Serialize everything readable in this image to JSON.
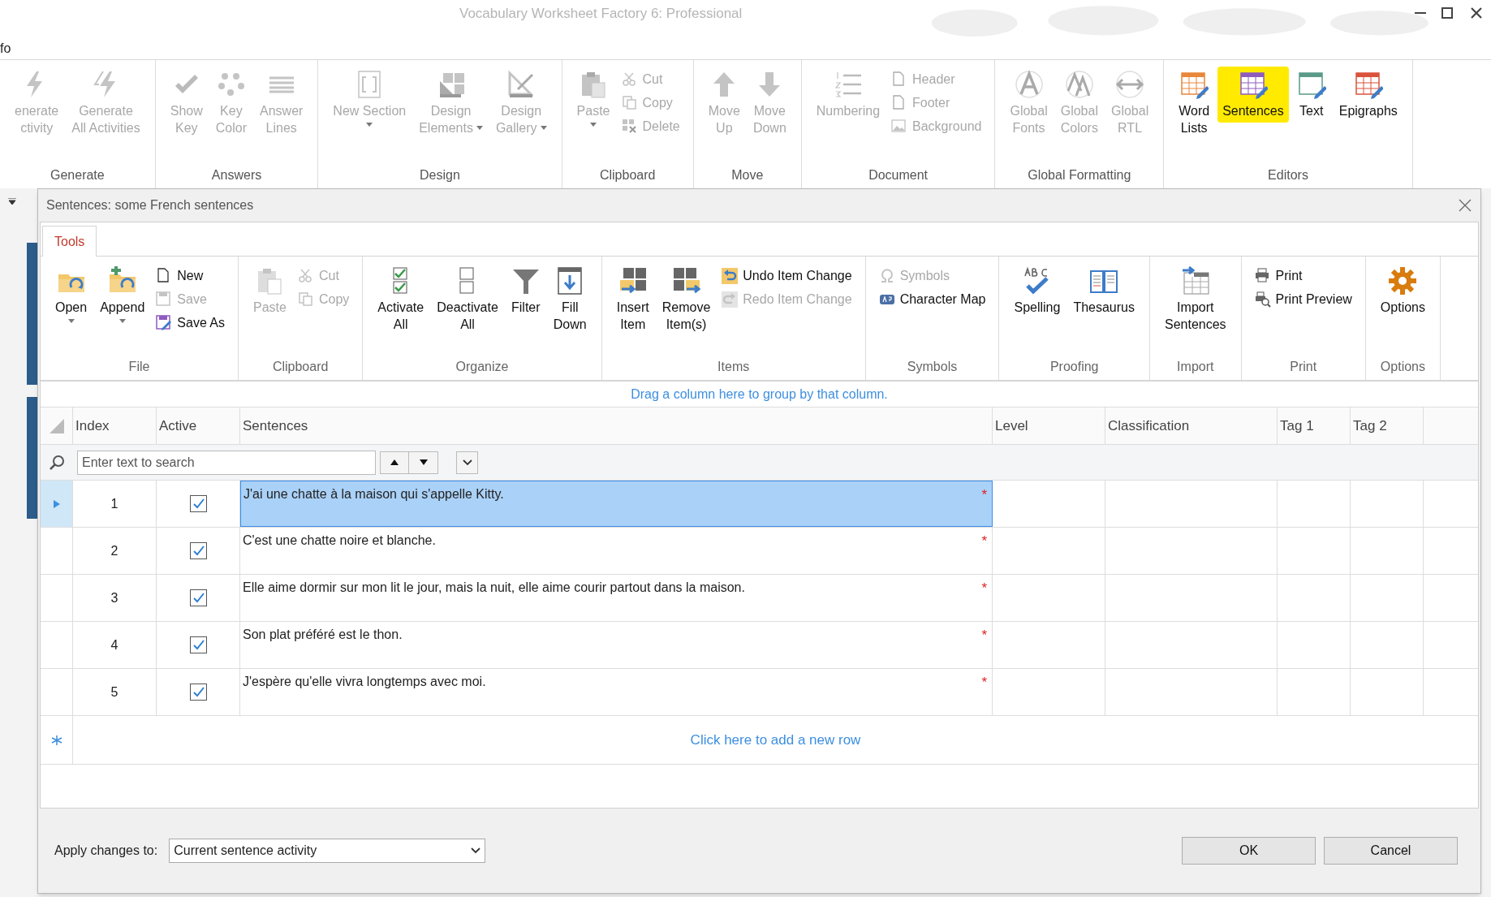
{
  "window": {
    "title": "Vocabulary Worksheet Factory 6: Professional",
    "menu_item": "fo"
  },
  "ribbon": {
    "groups": [
      {
        "label": "Generate",
        "items": [
          {
            "kind": "large",
            "lines": [
              "enerate",
              "ctivity"
            ],
            "disabled": true
          },
          {
            "kind": "large",
            "lines": [
              "Generate",
              "All Activities"
            ],
            "disabled": true
          }
        ]
      },
      {
        "label": "Answers",
        "items": [
          {
            "kind": "large",
            "lines": [
              "Show",
              "Key"
            ],
            "disabled": true
          },
          {
            "kind": "large",
            "lines": [
              "Key",
              "Color"
            ],
            "disabled": true
          },
          {
            "kind": "large",
            "lines": [
              "Answer",
              "Lines"
            ],
            "disabled": true
          }
        ]
      },
      {
        "label": "Design",
        "items": [
          {
            "kind": "large",
            "lines": [
              "New Section"
            ],
            "has_menu": true,
            "disabled": true
          },
          {
            "kind": "large",
            "lines": [
              "Design",
              "Elements"
            ],
            "has_menu": true,
            "disabled": true
          },
          {
            "kind": "large",
            "lines": [
              "Design",
              "Gallery"
            ],
            "has_menu": true,
            "disabled": true
          }
        ]
      },
      {
        "label": "Clipboard",
        "items": [
          {
            "kind": "large",
            "lines": [
              "Paste"
            ],
            "has_menu": true,
            "disabled": true
          },
          {
            "kind": "stack",
            "items": [
              {
                "label": "Cut",
                "disabled": true
              },
              {
                "label": "Copy",
                "disabled": true
              },
              {
                "label": "Delete",
                "disabled": true
              }
            ]
          }
        ]
      },
      {
        "label": "Move",
        "items": [
          {
            "kind": "large",
            "lines": [
              "Move",
              "Up"
            ],
            "disabled": true
          },
          {
            "kind": "large",
            "lines": [
              "Move",
              "Down"
            ],
            "disabled": true
          }
        ]
      },
      {
        "label": "Document",
        "items": [
          {
            "kind": "large",
            "lines": [
              "Numbering"
            ],
            "disabled": true
          },
          {
            "kind": "stack",
            "items": [
              {
                "label": "Header",
                "disabled": true
              },
              {
                "label": "Footer",
                "disabled": true
              },
              {
                "label": "Background",
                "disabled": true
              }
            ]
          }
        ]
      },
      {
        "label": "Global Formatting",
        "items": [
          {
            "kind": "large",
            "lines": [
              "Global",
              "Fonts"
            ],
            "disabled": true
          },
          {
            "kind": "large",
            "lines": [
              "Global",
              "Colors"
            ],
            "disabled": true
          },
          {
            "kind": "large",
            "lines": [
              "Global",
              "RTL"
            ],
            "disabled": true
          }
        ]
      },
      {
        "label": "Editors",
        "items": [
          {
            "kind": "large",
            "lines": [
              "Word",
              "Lists"
            ],
            "disabled": false,
            "highlighted": false
          },
          {
            "kind": "large",
            "lines": [
              "Sentences"
            ],
            "disabled": false,
            "highlighted": true
          },
          {
            "kind": "large",
            "lines": [
              "Text"
            ],
            "disabled": false,
            "highlighted": false
          },
          {
            "kind": "large",
            "lines": [
              "Epigraphs"
            ],
            "disabled": false,
            "highlighted": false
          }
        ]
      }
    ]
  },
  "dialog": {
    "title": "Sentences: some French sentences",
    "tabs": [
      {
        "label": "Tools",
        "selected": true
      }
    ],
    "groups": [
      {
        "label": "File",
        "items": [
          {
            "kind": "large",
            "lines": [
              "Open"
            ],
            "has_menu": true,
            "disabled": false
          },
          {
            "kind": "large",
            "lines": [
              "Append"
            ],
            "has_menu": true,
            "disabled": false
          },
          {
            "kind": "stack",
            "items": [
              {
                "label": "New",
                "disabled": false
              },
              {
                "label": "Save",
                "disabled": true
              },
              {
                "label": "Save As",
                "disabled": false
              }
            ]
          }
        ]
      },
      {
        "label": "Clipboard",
        "items": [
          {
            "kind": "large",
            "lines": [
              "Paste"
            ],
            "disabled": true
          },
          {
            "kind": "stack",
            "items": [
              {
                "label": "Cut",
                "disabled": true
              },
              {
                "label": "Copy",
                "disabled": true
              }
            ]
          }
        ]
      },
      {
        "label": "Organize",
        "items": [
          {
            "kind": "large",
            "lines": [
              "Activate",
              "All"
            ],
            "disabled": false
          },
          {
            "kind": "large",
            "lines": [
              "Deactivate",
              "All"
            ],
            "disabled": false
          },
          {
            "kind": "large",
            "lines": [
              "Filter"
            ],
            "disabled": false
          },
          {
            "kind": "large",
            "lines": [
              "Fill",
              "Down"
            ],
            "disabled": false
          }
        ]
      },
      {
        "label": "Items",
        "items": [
          {
            "kind": "large",
            "lines": [
              "Insert",
              "Item"
            ],
            "disabled": false
          },
          {
            "kind": "large",
            "lines": [
              "Remove",
              "Item(s)"
            ],
            "disabled": false
          },
          {
            "kind": "stack",
            "items": [
              {
                "label": "Undo Item Change",
                "disabled": false
              },
              {
                "label": "Redo Item Change",
                "disabled": true
              }
            ]
          }
        ]
      },
      {
        "label": "Symbols",
        "items": [
          {
            "kind": "stack",
            "items": [
              {
                "label": "Symbols",
                "disabled": true
              },
              {
                "label": "Character Map",
                "disabled": false
              }
            ]
          }
        ]
      },
      {
        "label": "Proofing",
        "items": [
          {
            "kind": "large",
            "lines": [
              "Spelling"
            ],
            "disabled": false
          },
          {
            "kind": "large",
            "lines": [
              "Thesaurus"
            ],
            "disabled": false
          }
        ]
      },
      {
        "label": "Import",
        "items": [
          {
            "kind": "large",
            "lines": [
              "Import",
              "Sentences"
            ],
            "disabled": false
          }
        ]
      },
      {
        "label": "Print",
        "items": [
          {
            "kind": "stack",
            "items": [
              {
                "label": "Print",
                "disabled": false
              },
              {
                "label": "Print Preview",
                "disabled": false
              }
            ]
          }
        ]
      },
      {
        "label": "Options",
        "items": [
          {
            "kind": "large",
            "lines": [
              "Options"
            ],
            "disabled": false
          }
        ]
      }
    ],
    "grid": {
      "group_hint": "Drag a column here to group by that column.",
      "columns": [
        "Index",
        "Active",
        "Sentences",
        "Level",
        "Classification",
        "Tag 1",
        "Tag 2"
      ],
      "search": {
        "placeholder": "Enter text to search"
      },
      "rows": [
        {
          "index": "1",
          "active": true,
          "sentence": "J'ai une chatte à la maison qui s'appelle Kitty.",
          "marker": "*",
          "selected": true
        },
        {
          "index": "2",
          "active": true,
          "sentence": "C'est une chatte noire et blanche.",
          "marker": "*",
          "selected": false
        },
        {
          "index": "3",
          "active": true,
          "sentence": "Elle aime dormir sur mon lit le jour, mais la nuit, elle aime courir partout dans la maison.",
          "marker": "*",
          "selected": false
        },
        {
          "index": "4",
          "active": true,
          "sentence": "Son plat préféré est le thon.",
          "marker": "*",
          "selected": false
        },
        {
          "index": "5",
          "active": true,
          "sentence": "J'espère qu'elle vivra longtemps avec moi.",
          "marker": "*",
          "selected": false
        }
      ],
      "new_row": "Click here to add a new row"
    },
    "footer": {
      "label": "Apply changes to:",
      "select_value": "Current sentence activity",
      "buttons": [
        "OK",
        "Cancel"
      ]
    }
  }
}
